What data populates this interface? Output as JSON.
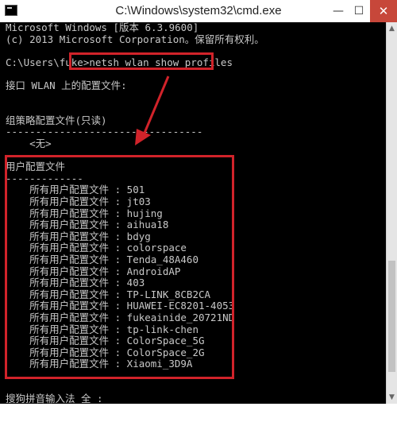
{
  "window": {
    "title": "C:\\Windows\\system32\\cmd.exe",
    "buttons": {
      "minimize": "—",
      "maximize": "☐",
      "close": "✕"
    }
  },
  "console": {
    "lines": [
      "Microsoft Windows [版本 6.3.9600]",
      "(c) 2013 Microsoft Corporation。保留所有权利。",
      "",
      "C:\\Users\\fuke>netsh wlan show profiles",
      "",
      "接口 WLAN 上的配置文件:",
      "",
      "",
      "组策略配置文件(只读)",
      "---------------------------------",
      "    <无>",
      "",
      "用户配置文件",
      "-------------",
      "    所有用户配置文件 : 501",
      "    所有用户配置文件 : jt03",
      "    所有用户配置文件 : hujing",
      "    所有用户配置文件 : aihua18",
      "    所有用户配置文件 : bdyg",
      "    所有用户配置文件 : colorspace",
      "    所有用户配置文件 : Tenda_48A460",
      "    所有用户配置文件 : AndroidAP",
      "    所有用户配置文件 : 403",
      "    所有用户配置文件 : TP-LINK_8CB2CA",
      "    所有用户配置文件 : HUAWEI-EC8201-4053",
      "    所有用户配置文件 : fukeainide_20721ND",
      "    所有用户配置文件 : tp-link-chen",
      "    所有用户配置文件 : ColorSpace_5G",
      "    所有用户配置文件 : ColorSpace_2G",
      "    所有用户配置文件 : Xiaomi_3D9A",
      "",
      "",
      "搜狗拼音输入法 全 :"
    ]
  },
  "annotations": {
    "color": "#d1232a"
  }
}
